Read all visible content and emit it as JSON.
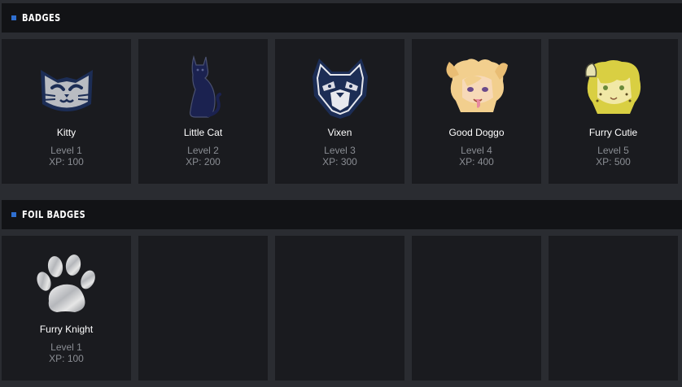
{
  "sections": [
    {
      "title": "Badges",
      "badges": [
        {
          "name": "Kitty",
          "level": "Level 1",
          "xp": "XP: 100",
          "icon": "kitty-face-icon"
        },
        {
          "name": "Little Cat",
          "level": "Level 2",
          "xp": "XP: 200",
          "icon": "sitting-cat-icon"
        },
        {
          "name": "Vixen",
          "level": "Level 3",
          "xp": "XP: 300",
          "icon": "wolf-face-icon"
        },
        {
          "name": "Good Doggo",
          "level": "Level 4",
          "xp": "XP: 400",
          "icon": "dog-girl-portrait-icon"
        },
        {
          "name": "Furry Cutie",
          "level": "Level 5",
          "xp": "XP: 500",
          "icon": "cheetah-girl-portrait-icon"
        }
      ]
    },
    {
      "title": "Foil Badges",
      "badges": [
        {
          "name": "Furry Knight",
          "level": "Level 1",
          "xp": "XP: 100",
          "icon": "silver-paw-icon"
        }
      ]
    }
  ],
  "colors": {
    "accent": "#2f6fd0",
    "card_bg": "#1a1b1f",
    "header_bg": "#121316",
    "page_bg": "#2a2c31",
    "muted_text": "#8a8d93"
  }
}
